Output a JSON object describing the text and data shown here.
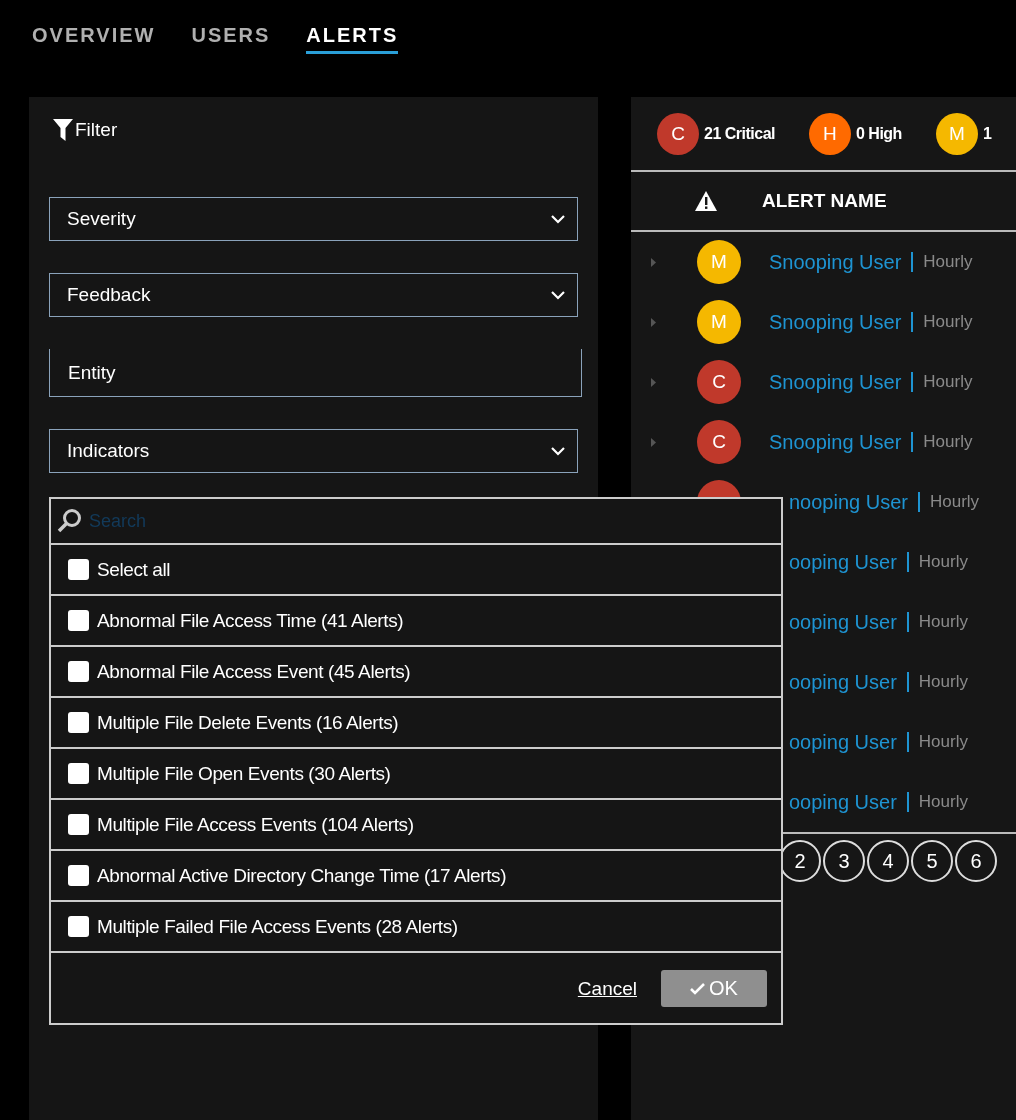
{
  "tabs": [
    {
      "label": "OVERVIEW",
      "selected": false
    },
    {
      "label": "USERS",
      "selected": false
    },
    {
      "label": "ALERTS",
      "selected": true
    }
  ],
  "filter": {
    "title": "Filter",
    "fields": [
      {
        "kind": "select",
        "label": "Severity"
      },
      {
        "kind": "select",
        "label": "Feedback"
      },
      {
        "kind": "text",
        "placeholder": "Entity"
      },
      {
        "kind": "select",
        "label": "Indicators"
      }
    ]
  },
  "dropdown": {
    "search_placeholder": "Search",
    "select_all": {
      "label": "Select all",
      "checked": false
    },
    "options": [
      {
        "label": "Abnormal File Access Time (41 Alerts)",
        "checked": false
      },
      {
        "label": "Abnormal File Access Event (45 Alerts)",
        "checked": false
      },
      {
        "label": "Multiple File Delete Events (16 Alerts)",
        "checked": false
      },
      {
        "label": "Multiple File Open Events (30 Alerts)",
        "checked": false
      },
      {
        "label": "Multiple File Access Events (104 Alerts)",
        "checked": false
      },
      {
        "label": "Abnormal Active Directory Change Time (17 Alerts)",
        "checked": false
      },
      {
        "label": "Multiple Failed File Access Events (28 Alerts)",
        "checked": false
      }
    ],
    "cancel": "Cancel",
    "ok": {
      "label": "OK",
      "disabled": true
    }
  },
  "summary": [
    {
      "letter": "C",
      "label": "21 Critical",
      "color": "#c0392b"
    },
    {
      "letter": "H",
      "label": "0 High",
      "color": "#ff6a00"
    },
    {
      "letter": "M",
      "label": "1",
      "color": "#f5b800"
    }
  ],
  "table": {
    "columns": [
      "ALERT NAME"
    ],
    "rows": [
      {
        "letter": "M",
        "color": "#f5b800",
        "name": "Snooping User",
        "frequency": "Hourly"
      },
      {
        "letter": "M",
        "color": "#f5b800",
        "name": "Snooping User",
        "frequency": "Hourly"
      },
      {
        "letter": "C",
        "color": "#c0392b",
        "name": "Snooping User",
        "frequency": "Hourly"
      },
      {
        "letter": "C",
        "color": "#c0392b",
        "name": "Snooping User",
        "frequency": "Hourly"
      },
      {
        "color": "#c0392b",
        "name": "nooping User",
        "frequency": "Hourly",
        "clipped": true
      },
      {
        "name": "ooping User",
        "frequency": "Hourly",
        "clipped": true
      },
      {
        "name": "ooping User",
        "frequency": "Hourly",
        "clipped": true
      },
      {
        "name": "ooping User",
        "frequency": "Hourly",
        "clipped": true
      },
      {
        "name": "ooping User",
        "frequency": "Hourly",
        "clipped": true
      },
      {
        "name": "ooping User",
        "frequency": "Hourly",
        "clipped": true
      }
    ]
  },
  "pages": [
    "2",
    "3",
    "4",
    "5",
    "6"
  ]
}
